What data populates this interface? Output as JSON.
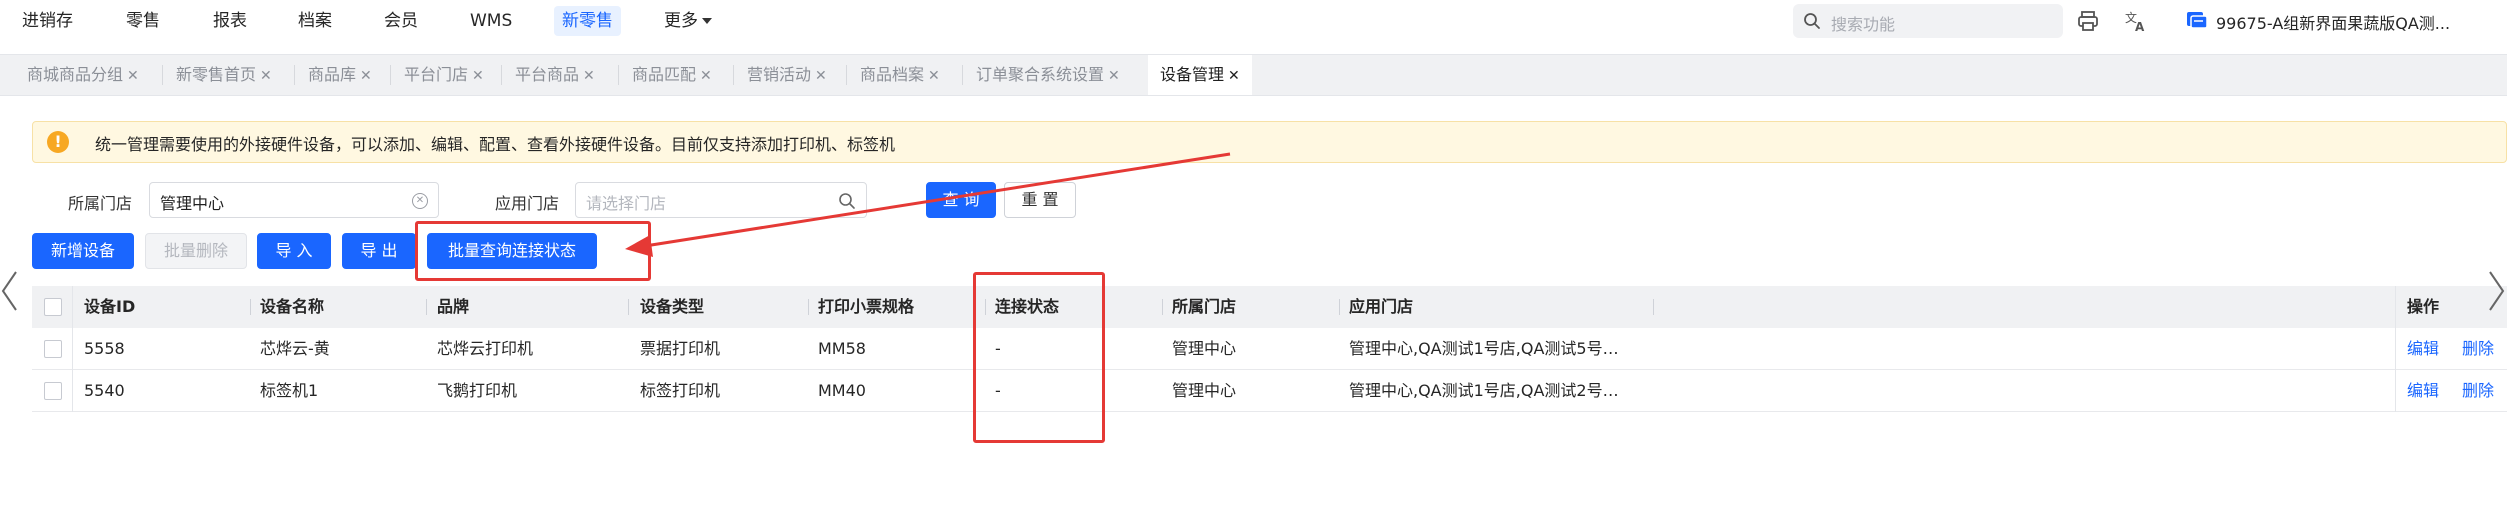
{
  "nav": {
    "items": [
      "进销存",
      "零售",
      "报表",
      "档案",
      "会员",
      "WMS",
      "新零售"
    ],
    "more_label": "更多",
    "active_index": 6,
    "search_placeholder": "搜索功能",
    "account_label": "99675-A组新界面果蔬版QA测..."
  },
  "tabs": [
    {
      "label": "商城商品分组"
    },
    {
      "label": "新零售首页"
    },
    {
      "label": "商品库"
    },
    {
      "label": "平台门店"
    },
    {
      "label": "平台商品"
    },
    {
      "label": "商品匹配"
    },
    {
      "label": "营销活动"
    },
    {
      "label": "商品档案"
    },
    {
      "label": "订单聚合系统设置"
    },
    {
      "label": "设备管理",
      "active": true
    }
  ],
  "banner": {
    "text": "统一管理需要使用的外接硬件设备，可以添加、编辑、配置、查看外接硬件设备。目前仅支持添加打印机、标签机"
  },
  "filters": {
    "store_label": "所属门店",
    "store_value": "管理中心",
    "applied_store_label": "应用门店",
    "applied_store_placeholder": "请选择门店",
    "query_button": "查 询",
    "reset_button": "重 置"
  },
  "toolbar": {
    "add": "新增设备",
    "batch_delete": "批量删除",
    "import": "导 入",
    "export": "导 出",
    "batch_query_status": "批量查询连接状态"
  },
  "table": {
    "headers": [
      "设备ID",
      "设备名称",
      "品牌",
      "设备类型",
      "打印小票规格",
      "连接状态",
      "所属门店",
      "应用门店",
      "操作"
    ],
    "rows": [
      {
        "id": "5558",
        "name": "芯烨云-黄",
        "brand": "芯烨云打印机",
        "type": "票据打印机",
        "spec": "MM58",
        "status": "-",
        "store": "管理中心",
        "applied": "管理中心,QA测试1号店,QA测试5号…",
        "edit": "编辑",
        "delete": "删除"
      },
      {
        "id": "5540",
        "name": "标签机1",
        "brand": "飞鹅打印机",
        "type": "标签打印机",
        "spec": "MM40",
        "status": "-",
        "store": "管理中心",
        "applied": "管理中心,QA测试1号店,QA测试2号…",
        "edit": "编辑",
        "delete": "删除"
      }
    ]
  },
  "colors": {
    "primary": "#1a66ff",
    "annotation": "#e53935",
    "warning": "#f7a823"
  }
}
